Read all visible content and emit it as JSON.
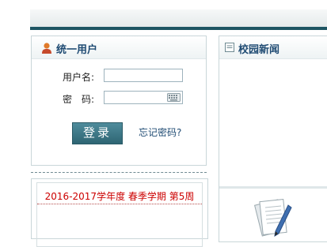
{
  "login": {
    "title": "统一用户",
    "username_label": "用户名:",
    "password_label": "密　码:",
    "username_value": "",
    "password_value": "",
    "login_button": "登录",
    "forgot_link": "忘记密码?"
  },
  "term": {
    "text": "2016-2017学年度 春季学期 第5周"
  },
  "news": {
    "title": "校园新闻"
  },
  "icons": {
    "user": "user-icon",
    "keyboard": "keyboard-icon",
    "news": "news-icon",
    "document": "document-pen-icon"
  },
  "colors": {
    "accent": "#1d5563",
    "title": "#1f4b73",
    "term_text": "#cc0000"
  }
}
